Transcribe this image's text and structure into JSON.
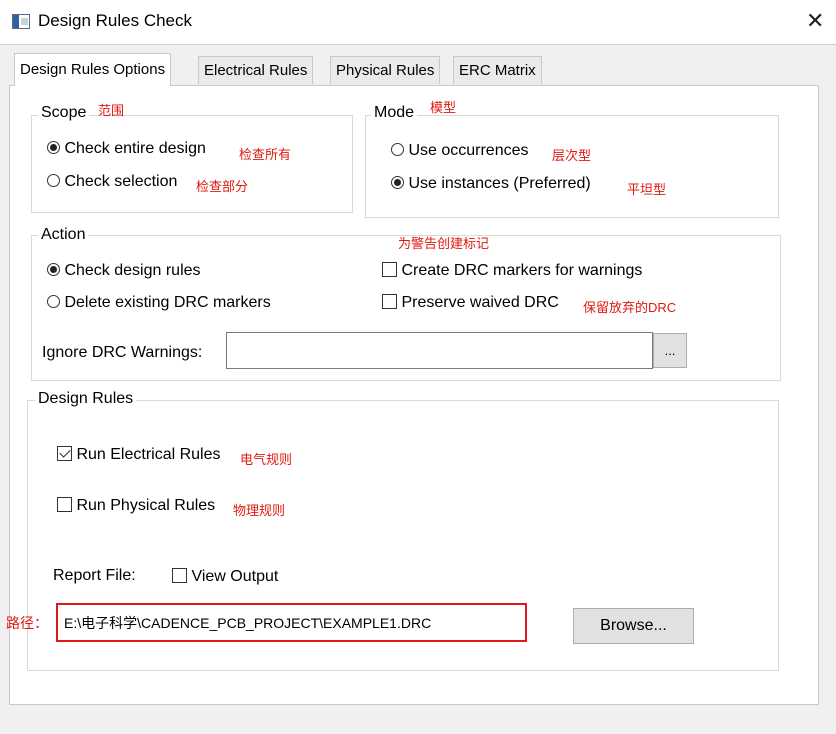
{
  "window": {
    "title": "Design Rules Check",
    "close_glyph": "✕"
  },
  "tabs": [
    {
      "label": "Design Rules Options",
      "active": true
    },
    {
      "label": "Electrical Rules"
    },
    {
      "label": "Physical Rules"
    },
    {
      "label": "ERC Matrix"
    }
  ],
  "scope": {
    "legend": "Scope",
    "note": "范围",
    "options": [
      {
        "label": "Check entire design",
        "checked": true,
        "note": "检查所有"
      },
      {
        "label": "Check selection",
        "checked": false,
        "note": "检查部分"
      }
    ]
  },
  "mode": {
    "legend": "Mode",
    "note": "模型",
    "options": [
      {
        "label": "Use occurrences",
        "checked": false,
        "note": "层次型"
      },
      {
        "label": "Use instances (Preferred)",
        "checked": true,
        "note": "平坦型"
      }
    ]
  },
  "action": {
    "legend": "Action",
    "warnings_note": "为警告创建标记",
    "radios": [
      {
        "label": "Check design rules",
        "checked": true
      },
      {
        "label": "Delete existing DRC markers",
        "checked": false
      }
    ],
    "checkboxes": [
      {
        "label": "Create DRC markers for warnings",
        "checked": false
      },
      {
        "label": "Preserve waived DRC",
        "checked": false,
        "note": "保留放弃的DRC"
      }
    ],
    "ignore_label": "Ignore DRC Warnings:",
    "ignore_value": "",
    "ellipsis_label": "..."
  },
  "design_rules": {
    "legend": "Design Rules",
    "run_electrical": {
      "label": "Run Electrical Rules",
      "checked": true,
      "note": "电气规则"
    },
    "run_physical": {
      "label": "Run Physical Rules",
      "checked": false,
      "note": "物理规则"
    },
    "report_label": "Report File:",
    "view_output": {
      "label": "View Output",
      "checked": false
    },
    "path_note": "路径：",
    "path_value": "E:\\电子科学\\CADENCE_PCB_PROJECT\\EXAMPLE1.DRC",
    "browse_label": "Browse..."
  },
  "colors": {
    "annotation_red": "#e0190f",
    "highlight_box": "#e01818"
  }
}
